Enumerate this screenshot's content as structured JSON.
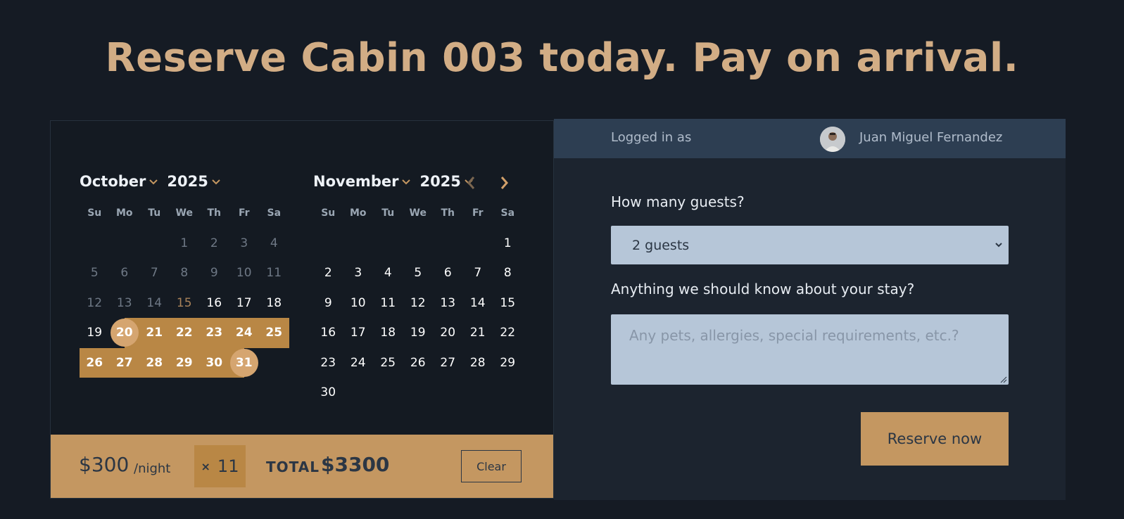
{
  "headline": "Reserve Cabin 003 today. Pay on arrival.",
  "calendar": {
    "left": {
      "month": "October",
      "year": "2025"
    },
    "right": {
      "month": "November",
      "year": "2025"
    },
    "weekdays": [
      "Su",
      "Mo",
      "Tu",
      "We",
      "Th",
      "Fr",
      "Sa"
    ],
    "october_days": [
      "",
      "",
      "",
      "1",
      "2",
      "3",
      "4",
      "5",
      "6",
      "7",
      "8",
      "9",
      "10",
      "11",
      "12",
      "13",
      "14",
      "15",
      "16",
      "17",
      "18",
      "19",
      "20",
      "21",
      "22",
      "23",
      "24",
      "25",
      "26",
      "27",
      "28",
      "29",
      "30",
      "31",
      ""
    ],
    "november_days": [
      "",
      "",
      "",
      "",
      "",
      "",
      "1",
      "2",
      "3",
      "4",
      "5",
      "6",
      "7",
      "8",
      "9",
      "10",
      "11",
      "12",
      "13",
      "14",
      "15",
      "16",
      "17",
      "18",
      "19",
      "20",
      "21",
      "22",
      "23",
      "24",
      "25",
      "26",
      "27",
      "28",
      "29",
      "30",
      "",
      "",
      "",
      "",
      "",
      ""
    ],
    "past_through_day": 14,
    "today_day": 15,
    "range_start_day": 20,
    "range_end_day": 31
  },
  "pricing": {
    "price": "$300",
    "per_night": "/night",
    "nights_x": "×",
    "nights": "11",
    "total_label": "TOTAL",
    "total_value": "$3300",
    "clear_label": "Clear"
  },
  "login": {
    "logged_in_label": "Logged in as",
    "user_name": "Juan Miguel Fernandez"
  },
  "form": {
    "guests_label": "How many guests?",
    "guests_value": "2 guests",
    "notes_label": "Anything we should know about your stay?",
    "notes_placeholder": "Any pets, allergies, special requirements, etc.?",
    "reserve_label": "Reserve now"
  },
  "colors": {
    "accent": "#c49761",
    "range": "#b98745",
    "headline": "#d2ad85",
    "background": "#151b24"
  },
  "icons": [
    "chevron-down-icon",
    "chevron-left-icon",
    "chevron-right-icon",
    "select-caret-icon",
    "resize-grip-icon"
  ]
}
